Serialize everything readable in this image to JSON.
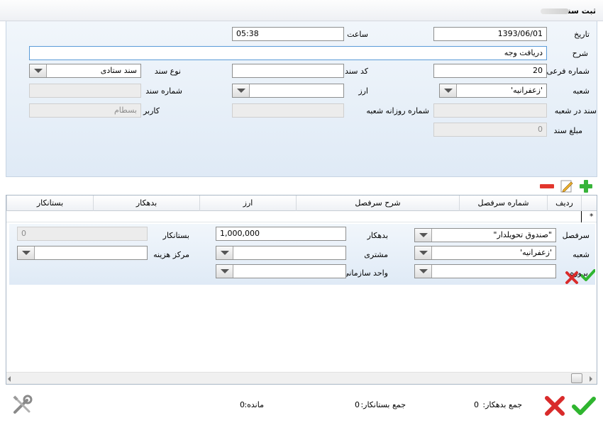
{
  "window": {
    "title": "ثبت سند"
  },
  "header": {
    "date_label": "تاریخ",
    "date_value": "1393/06/01",
    "time_label": "ساعت",
    "time_value": "05:38",
    "desc_label": "شرح",
    "desc_value": "دریافت وجه",
    "sub_no_label": "شماره فرعی",
    "sub_no_value": "20",
    "doc_code_label": "کد سند",
    "doc_code_value": "",
    "doc_type_label": "نوع سند",
    "doc_type_value": "سند ستادی",
    "branch_label": "شعبه",
    "branch_value": "'زعفرانیه'",
    "currency_label": "ارز",
    "currency_value": "",
    "doc_no_label": "شماره سند",
    "doc_no_value": "",
    "doc_in_branch_label": "سند در شعبه",
    "doc_in_branch_value": "",
    "branch_daily_label": "شماره روزانه شعبه",
    "branch_daily_value": "",
    "user_label": "کاربر",
    "user_value": "بسطام",
    "amount_label": "مبلغ سند",
    "amount_value": "0"
  },
  "grid": {
    "columns": [
      "ردیف",
      "شماره سرفصل",
      "شرح سرفصل",
      "ارز",
      "بدهکار",
      "بستانکار"
    ],
    "new_row_marker": "*"
  },
  "detail": {
    "account_label": "سرفصل",
    "account_value": "\"صندوق تحویلدار\"",
    "debit_label": "بدهکار",
    "debit_value": "1,000,000",
    "credit_label": "بستانکار",
    "credit_value": "0",
    "branch_label": "شعبه",
    "branch_value": "'زعفرانیه'",
    "customer_label": "مشتری",
    "customer_value": "",
    "cost_center_label": "مرکز هزینه",
    "cost_center_value": "",
    "project_label": "پروژه",
    "project_value": "",
    "org_unit_label": "واحد سازمانی",
    "org_unit_value": ""
  },
  "footer": {
    "debit_total_label": "جمع بدهکار:",
    "debit_total_value": "0",
    "credit_total_label": "جمع بستانکار:",
    "credit_total_value": "0",
    "remaining_label": "مانده:",
    "remaining_value": "0"
  },
  "colors": {
    "accent_blue": "#dfeaf6",
    "ok_green": "#2fb52f",
    "cancel_red": "#d92b2b"
  }
}
